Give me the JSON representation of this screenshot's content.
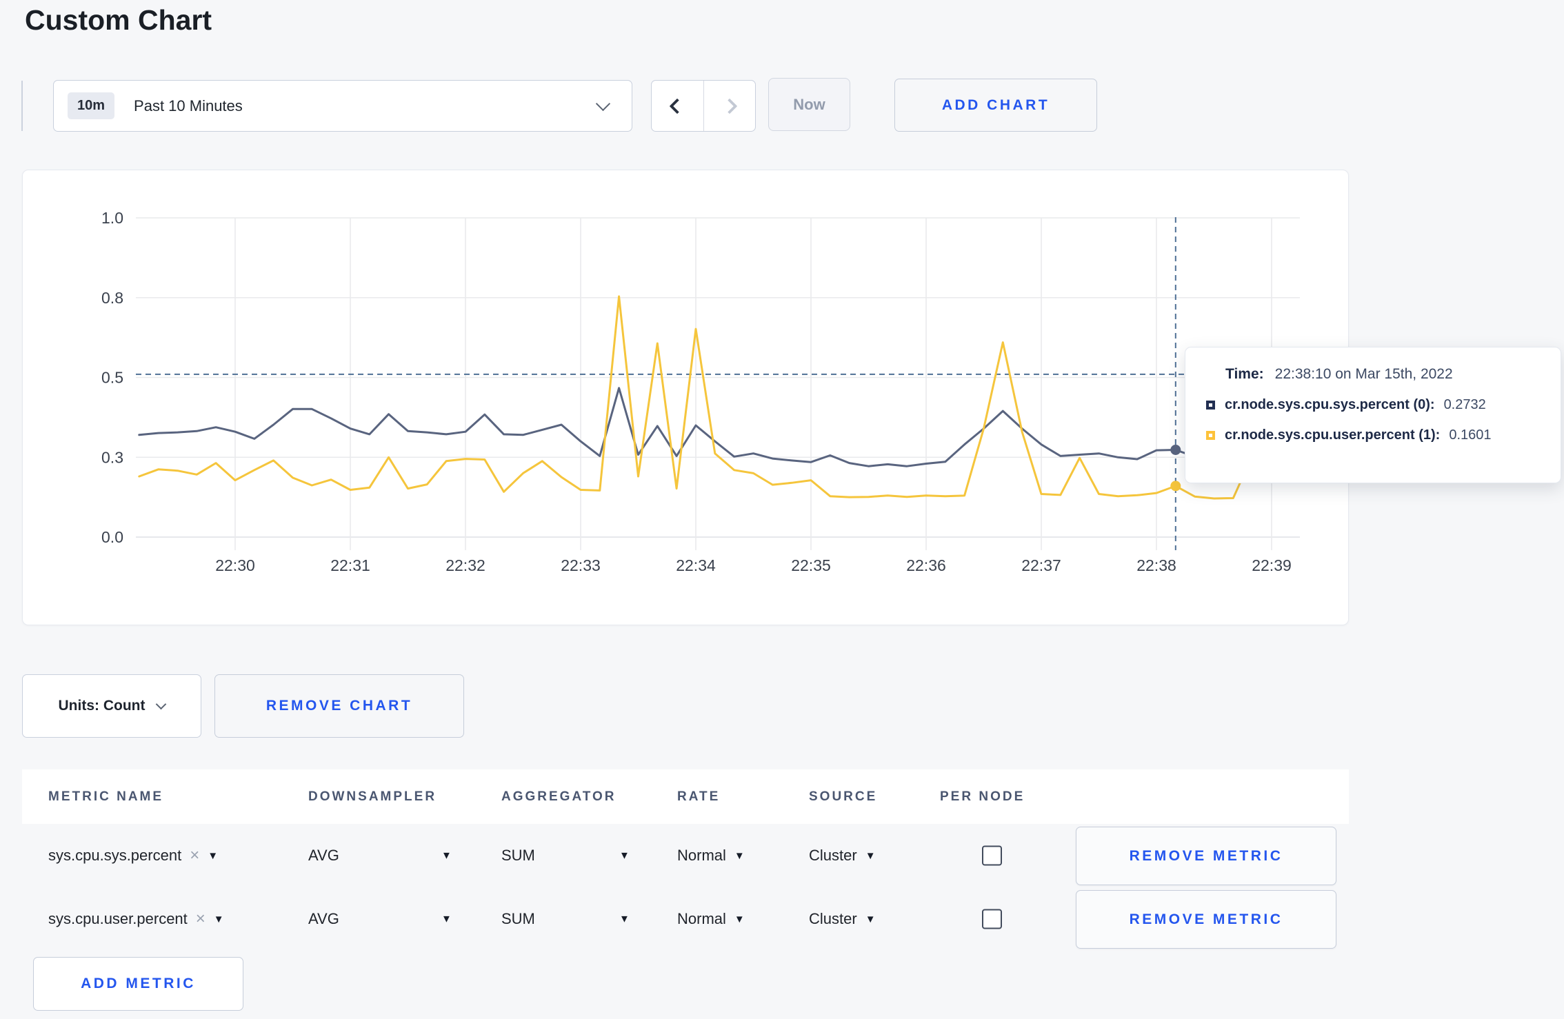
{
  "page": {
    "title": "Custom Chart",
    "background": "#f6f7f9",
    "accent_blue": "#2456ee"
  },
  "toolbar": {
    "range_badge": "10m",
    "range_label": "Past 10 Minutes",
    "now_label": "Now",
    "add_chart_label": "ADD CHART"
  },
  "chart_data": {
    "type": "line",
    "title": "",
    "xlabel": "",
    "ylabel": "",
    "ylim": [
      0,
      1
    ],
    "grid": true,
    "x_tick_labels": [
      "22:30",
      "22:31",
      "22:32",
      "22:33",
      "22:34",
      "22:35",
      "22:36",
      "22:37",
      "22:38",
      "22:39"
    ],
    "y_tick_labels": [
      "0.0",
      "0.3",
      "0.5",
      "0.8",
      "1.0"
    ],
    "y_tick_values": [
      0,
      0.25,
      0.5,
      0.75,
      1.0
    ],
    "x_start_time": "22:29:10",
    "x_step_seconds": 10,
    "grid_color": "#e9eaec",
    "series": [
      {
        "name": "cr.node.sys.cpu.sys.percent",
        "color": "#59647f",
        "values": [
          0.32,
          0.326,
          0.328,
          0.332,
          0.344,
          0.33,
          0.308,
          0.352,
          0.401,
          0.401,
          0.372,
          0.34,
          0.322,
          0.385,
          0.332,
          0.328,
          0.322,
          0.33,
          0.384,
          0.322,
          0.32,
          0.336,
          0.352,
          0.3,
          0.254,
          0.467,
          0.258,
          0.348,
          0.254,
          0.35,
          0.3,
          0.252,
          0.262,
          0.246,
          0.24,
          0.235,
          0.256,
          0.232,
          0.222,
          0.228,
          0.222,
          0.23,
          0.236,
          0.29,
          0.34,
          0.395,
          0.34,
          0.29,
          0.254,
          0.258,
          0.262,
          0.25,
          0.244,
          0.272,
          0.2732,
          0.252,
          0.268,
          0.252,
          0.246,
          0.252
        ]
      },
      {
        "name": "cr.node.sys.cpu.user.percent",
        "color": "#f5c53c",
        "values": [
          0.19,
          0.212,
          0.208,
          0.196,
          0.232,
          0.178,
          0.21,
          0.24,
          0.186,
          0.162,
          0.18,
          0.148,
          0.155,
          0.25,
          0.152,
          0.165,
          0.238,
          0.245,
          0.243,
          0.142,
          0.2,
          0.238,
          0.188,
          0.148,
          0.146,
          0.754,
          0.19,
          0.607,
          0.152,
          0.652,
          0.262,
          0.21,
          0.2,
          0.164,
          0.17,
          0.178,
          0.128,
          0.125,
          0.126,
          0.13,
          0.126,
          0.13,
          0.128,
          0.13,
          0.34,
          0.61,
          0.33,
          0.135,
          0.132,
          0.248,
          0.135,
          0.128,
          0.131,
          0.138,
          0.1601,
          0.127,
          0.121,
          0.122,
          0.255,
          0.173
        ]
      }
    ],
    "hover": {
      "index": 54,
      "time": "22:38:10",
      "values": [
        0.2732,
        0.1601
      ],
      "h_guide_value": 0.51,
      "guide_color": "#4f7095"
    },
    "legend_position": "tooltip"
  },
  "tooltip": {
    "time_label": "Time:",
    "time_value": "22:38:10 on Mar 15th, 2022",
    "rows": [
      {
        "label": "cr.node.sys.cpu.sys.percent (0):",
        "value": "0.2732",
        "color": "#222f52"
      },
      {
        "label": "cr.node.sys.cpu.user.percent (1):",
        "value": "0.1601",
        "color": "#fdc23a"
      }
    ]
  },
  "units_bar": {
    "units_label": "Units: Count",
    "remove_chart_label": "REMOVE CHART"
  },
  "table": {
    "headers": [
      "METRIC NAME",
      "DOWNSAMPLER",
      "AGGREGATOR",
      "RATE",
      "SOURCE",
      "PER NODE"
    ],
    "remove_icon": "×",
    "dropdown_arrow": "▼",
    "rows": [
      {
        "name": "sys.cpu.sys.percent",
        "downsampler": "AVG",
        "aggregator": "SUM",
        "rate": "Normal",
        "source": "Cluster",
        "per_node_checked": false
      },
      {
        "name": "sys.cpu.user.percent",
        "downsampler": "AVG",
        "aggregator": "SUM",
        "rate": "Normal",
        "source": "Cluster",
        "per_node_checked": false
      }
    ],
    "remove_metric_label": "REMOVE METRIC",
    "add_metric_label": "ADD METRIC"
  }
}
